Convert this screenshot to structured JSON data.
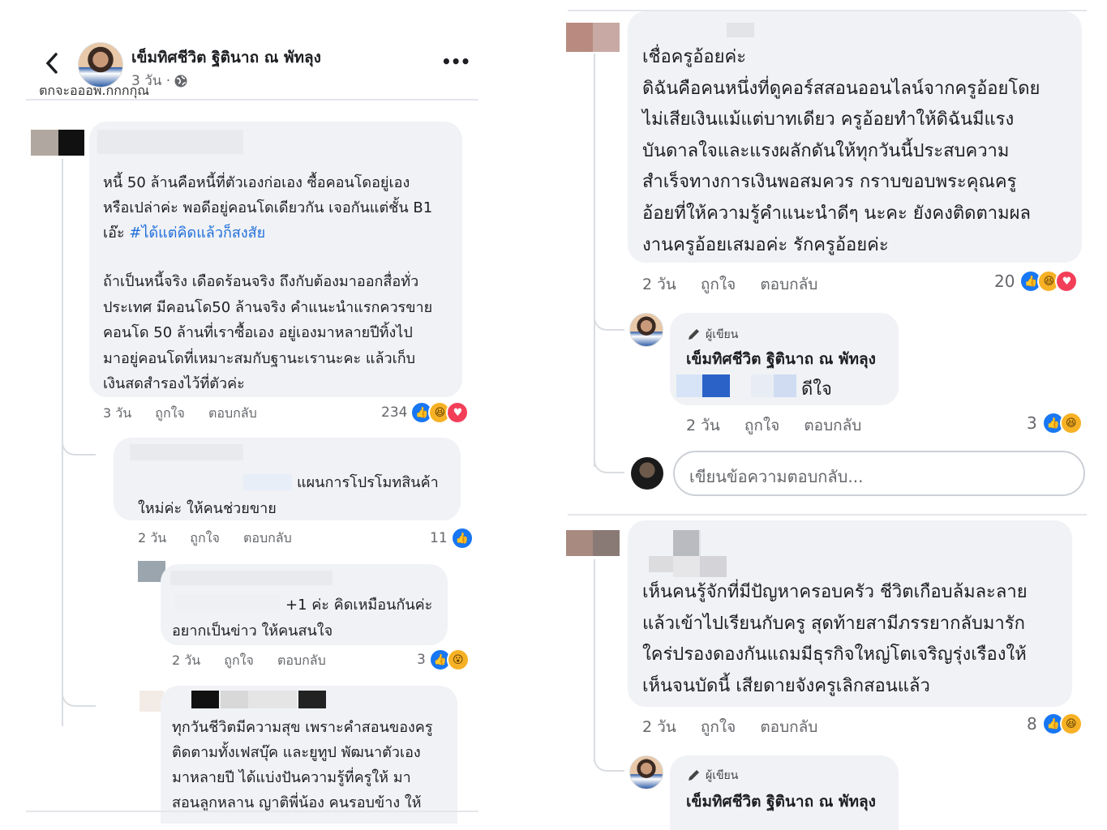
{
  "header": {
    "back_icon": "chevron-left-icon",
    "author_name": "เข็มทิศชีวิต ฐิตินาถ ณ พัทลุง",
    "post_time": "3 วัน ·",
    "globe_icon": "globe-icon",
    "more_icon": "more-horizontal-icon",
    "more_label": "•••",
    "cut_text": "ตกจะอออพ.กกกกุณ"
  },
  "left": {
    "comment1": {
      "text_part1": "หนี้ 50 ล้านคือหนี้ที่ตัวเองก่อเอง ซื้อคอนโดอยู่เอง\nหรือเปล่าค่ะ พอดีอยู่คอนโดเดียวกัน เจอกันแต่ชั้น B1\nเอ๊ะ ",
      "hashtag": "#ได้แต่คิดแล้วก็สงสัย",
      "text_part2": "ถ้าเป็นหนี้จริง เดือดร้อนจริง ถึงกับต้องมาออกสื่อทั่ว\nประเทศ มีคอนโด50 ล้านจริง คำแนะนำแรกควรขาย\nคอนโด 50 ล้านที่เราซื้อเอง อยู่เองมาหลายปีทิ้งไป\nมาอยู่คอนโดที่เหมาะสมกับฐานะเรานะคะ แล้วเก็บ\nเงินสดสำรองไว้ที่ตัวค่ะ",
      "time": "3 วัน",
      "like": "ถูกใจ",
      "reply": "ตอบกลับ",
      "count": "234"
    },
    "comment2": {
      "text_line1": "แผนการโปรโมทสินค้า",
      "text_line2": "ใหม่ค่ะ ให้คนช่วยขาย",
      "time": "2 วัน",
      "like": "ถูกใจ",
      "reply": "ตอบกลับ",
      "count": "11"
    },
    "comment3": {
      "text_line1": "+1 ค่ะ คิดเหมือนกันค่ะ",
      "text_line2": "อยากเป็นข่าว ให้คนสนใจ",
      "time": "2 วัน",
      "like": "ถูกใจ",
      "reply": "ตอบกลับ",
      "count": "3"
    },
    "comment4": {
      "text": "ทุกวันชีวิตมีความสุข เพราะคำสอนของครู\nติดตามทั้งเฟสบุ๊ค และยูทูป พัฒนาตัวเอง\nมาหลายปี ได้แบ่งปันความรู้ที่ครูให้ มา\nสอนลูกหลาน ญาติพี่น้อง คนรอบข้าง ให้"
    }
  },
  "right": {
    "comment1": {
      "text": "เชื่อครูอ้อยค่ะ\nดิฉันคือคนหนึ่งที่ดูคอร์สสอนออนไลน์จากครูอ้อยโดย\nไม่เสียเงินแม้แต่บาทเดียว ครูอ้อยทำให้ดิฉันมีแรง\nบันดาลใจและแรงผลักดันให้ทุกวันนี้ประสบความ\nสำเร็จทางการเงินพอสมควร กราบขอบพระคุณครู\nอ้อยที่ให้ความรู้คำแนะนำดีๆ นะคะ ยังคงติดตามผล\nงานครูอ้อยเสมอค่ะ รักครูอ้อยค่ะ",
      "time": "2 วัน",
      "like": "ถูกใจ",
      "reply": "ตอบกลับ",
      "count": "20"
    },
    "author_reply1": {
      "badge_icon": "pencil-icon",
      "badge": "ผู้เขียน",
      "name": "เข็มทิศชีวิต ฐิตินาถ ณ พัทลุง",
      "text": "ดีใจ",
      "time": "2 วัน",
      "like": "ถูกใจ",
      "reply": "ตอบกลับ",
      "count": "3"
    },
    "reply_input_placeholder": "เขียนข้อความตอบกลับ...",
    "comment2": {
      "text": "เห็นคนรู้จักที่มีปัญหาครอบครัว ชีวิตเกือบล้มละลาย\nแล้วเข้าไปเรียนกับครู สุดท้ายสามีภรรยากลับมารัก\nใคร่ปรองดองกันแถมมีธุรกิจใหญ่โตเจริญรุ่งเรืองให้\nเห็นจนบัดนี้ เสียดายจังครูเลิกสอนแล้ว",
      "time": "2 วัน",
      "like": "ถูกใจ",
      "reply": "ตอบกลับ",
      "count": "8"
    },
    "author_reply2": {
      "badge_icon": "pencil-icon",
      "badge": "ผู้เขียน",
      "name": "เข็มทิศชีวิต ฐิตินาถ ณ พัทลุง"
    }
  },
  "colors": {
    "bubble": "#f0f2f5",
    "like_blue": "#1877f2",
    "hashtag": "#216fdb",
    "meta_gray": "#65676b"
  }
}
